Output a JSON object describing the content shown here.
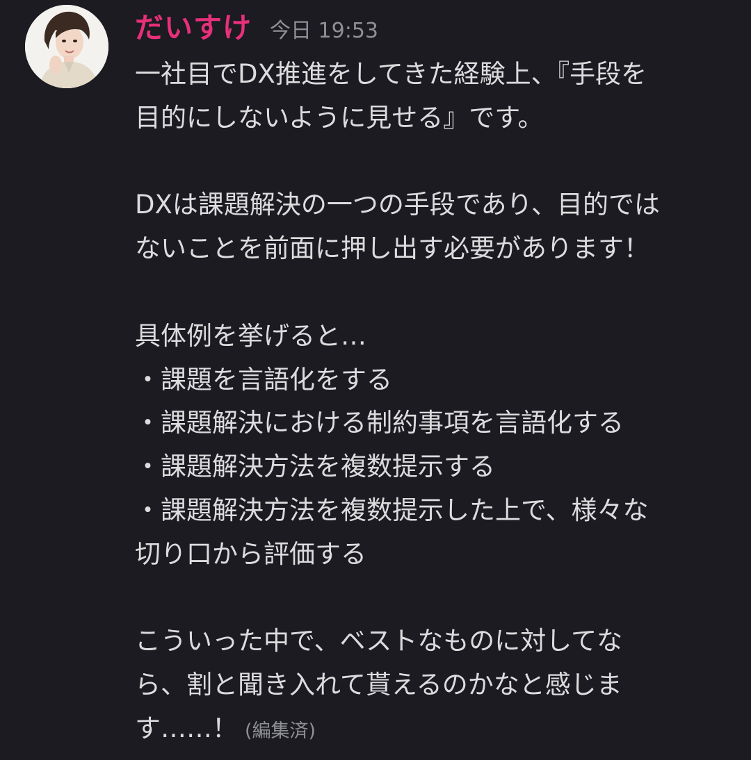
{
  "message": {
    "author": "だいすけ",
    "timestamp": "今日 19:53",
    "lines": [
      "一社目でDX推進をしてきた経験上、『手段を",
      "目的にしないように見せる』です。",
      "",
      "DXは課題解決の一つの手段であり、目的では",
      "ないことを前面に押し出す必要があります！",
      "",
      "具体例を挙げると…",
      "・課題を言語化をする",
      "・課題解決における制約事項を言語化する",
      "・課題解決方法を複数提示する",
      "・課題解決方法を複数提示した上で、様々な",
      "切り口から評価する",
      "",
      "こういった中で、ベストなものに対してな",
      "ら、割と聞き入れて貰えるのかなと感じま",
      "す……！"
    ],
    "edited_label": "(編集済)"
  },
  "colors": {
    "background": "#1b1b21",
    "author": "#e8307a",
    "text": "#dcdcde",
    "muted": "#8f9096"
  }
}
